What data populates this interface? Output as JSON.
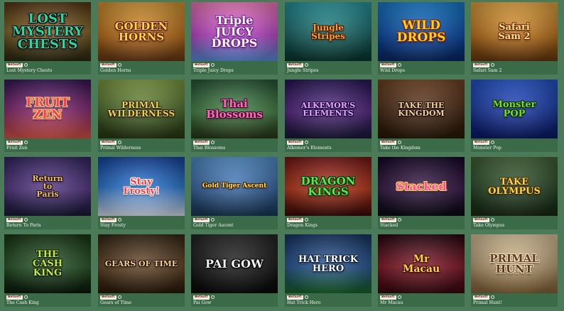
{
  "games": [
    {
      "id": "lost-mystery-chests",
      "name": "Lost Mystery Chests",
      "logo": "LOST\nMYSTERY CHESTS",
      "provider_badge": "Betsoft",
      "bg": "linear-gradient(180deg,#5a3a18,#8a6a2a 50%,#2a2a14)",
      "fg": "#2fd4a6",
      "shadow": "#000"
    },
    {
      "id": "golden-horns",
      "name": "Golden Horns",
      "logo": "GOLDEN\nHORNS",
      "provider_badge": "Betsoft",
      "bg": "linear-gradient(180deg,#e2a23a,#c2701a 60%,#6a3a14)",
      "fg": "#ffd24a",
      "shadow": "#5a1a08"
    },
    {
      "id": "triple-juicy-drops",
      "name": "Triple Juicy Drops",
      "logo": "Triple\nJUICY\nDROPS",
      "provider_badge": "Betsoft",
      "bg": "linear-gradient(180deg,#ff86c8,#c84ad4 55%,#5a9ae8)",
      "fg": "#ffffff",
      "shadow": "#7a1a9a"
    },
    {
      "id": "jungle-stripes",
      "name": "Jungle Stripes",
      "logo": "Jungle\nStripes",
      "provider_badge": "Betsoft",
      "bg": "linear-gradient(180deg,#2aa0a8,#1a6a6a 55%,#0a3a30)",
      "fg": "#ff9a2a",
      "shadow": "#3a1a0a"
    },
    {
      "id": "wild-drops",
      "name": "Wild Drops",
      "logo": "WILD\nDROPS",
      "provider_badge": "Betsoft",
      "bg": "linear-gradient(180deg,#1a86d8,#0a4aa8 60%,#0a2a6a)",
      "fg": "#ffd21a",
      "shadow": "#7a1a0a"
    },
    {
      "id": "safari-sam-2",
      "name": "Safari Sam 2",
      "logo": "Safari\nSam 2",
      "provider_badge": "Betsoft",
      "bg": "linear-gradient(180deg,#f2b24a,#c2741a 60%,#6a3a10)",
      "fg": "#ffe08a",
      "shadow": "#6a2a0a"
    },
    {
      "id": "fruit-zen",
      "name": "Fruit Zen",
      "logo": "FRUIT\nZEN",
      "provider_badge": "Betsoft",
      "bg": "linear-gradient(180deg,#3a1a5a,#8a2a7a 50%,#e85a4a)",
      "fg": "#ff3a4a",
      "shadow": "#ffe08a"
    },
    {
      "id": "primal-wilderness",
      "name": "Primal Wilderness",
      "logo": "PRIMAL\nWILDERNESS",
      "provider_badge": "Betsoft",
      "bg": "linear-gradient(180deg,#8aa84a,#4a6a2a 60%,#2a3a14)",
      "fg": "#e8d84a",
      "shadow": "#2a1a08"
    },
    {
      "id": "thai-blossoms",
      "name": "Thai Blossoms",
      "logo": "Thai\nBlossoms",
      "provider_badge": "Betsoft",
      "bg": "linear-gradient(180deg,#2a5a3a,#4a8a4a 55%,#2a3a1a)",
      "fg": "#ff6ab8",
      "shadow": "#3a0a2a"
    },
    {
      "id": "alkemors-elements",
      "name": "Alkemor's Elements",
      "logo": "ALKEMOR'S\nELEMENTS",
      "provider_badge": "Betsoft",
      "bg": "linear-gradient(180deg,#2a1a5a,#5a2a8a 55%,#1a1a3a)",
      "fg": "#e8a8ff",
      "shadow": "#1a0a3a"
    },
    {
      "id": "take-the-kingdom",
      "name": "Take the Kingdom",
      "logo": "TAKE THE\nKINGDOM",
      "provider_badge": "Betsoft",
      "bg": "linear-gradient(180deg,#7a4a2a,#4a2a14 55%,#2a1a0a)",
      "fg": "#f2d4a2",
      "shadow": "#1a0a04"
    },
    {
      "id": "monster-pop",
      "name": "Monster Pop",
      "logo": "Monster\nPOP",
      "provider_badge": "Betsoft",
      "bg": "linear-gradient(180deg,#2a5ad8,#1a3aa8 55%,#0a1a6a)",
      "fg": "#7adc2a",
      "shadow": "#0a2a0a"
    },
    {
      "id": "return-to-paris",
      "name": "Return To Paris",
      "logo": "Return\nto\nParis",
      "provider_badge": "Betsoft",
      "bg": "linear-gradient(180deg,#3a2a6a,#5a3a8a 55%,#1a1a3a)",
      "fg": "#f2c24a",
      "shadow": "#1a0a2a"
    },
    {
      "id": "stay-frosty",
      "name": "Stay Frosty",
      "logo": "Stay\nFrosty!",
      "provider_badge": "Betsoft",
      "bg": "linear-gradient(180deg,#1a4aa8,#2a7ad8 50%,#e8f2ff)",
      "fg": "#ff3a3a",
      "shadow": "#ffffff"
    },
    {
      "id": "gold-tiger-ascent",
      "name": "Gold Tiger Ascent",
      "logo": "Gold Tiger Ascent",
      "provider_badge": "Betsoft",
      "bg": "linear-gradient(180deg,#5a9ad8,#3a6aa8 55%,#1a3a5a)",
      "fg": "#ffe04a",
      "shadow": "#3a1a08"
    },
    {
      "id": "dragon-kings",
      "name": "Dragon Kings",
      "logo": "DRAGON\nKINGS",
      "provider_badge": "Betsoft",
      "bg": "linear-gradient(180deg,#7a1a1a,#c23a1a 55%,#3a0a08)",
      "fg": "#5ae84a",
      "shadow": "#0a2a0a"
    },
    {
      "id": "stacked",
      "name": "Stacked",
      "logo": "Stacked",
      "provider_badge": "Betsoft",
      "bg": "linear-gradient(180deg,#1a0a2a,#3a1a4a 55%,#0a0a14)",
      "fg": "#ff4ac2",
      "shadow": "#ffe04a"
    },
    {
      "id": "take-olympus",
      "name": "Take Olympus",
      "logo": "TAKE\nOLYMPUS",
      "provider_badge": "Betsoft",
      "bg": "linear-gradient(180deg,#4a6a3a,#2a4a2a 55%,#1a2a14)",
      "fg": "#ffd24a",
      "shadow": "#3a2a08"
    },
    {
      "id": "the-cash-king",
      "name": "The Cash King",
      "logo": "THE\nCASH\nKING",
      "provider_badge": "Betsoft",
      "bg": "linear-gradient(180deg,#1a3a1a,#2a5a2a 55%,#0a1a0a)",
      "fg": "#c8e84a",
      "shadow": "#0a1a04"
    },
    {
      "id": "gears-of-time",
      "name": "Gears of Time",
      "logo": "GEARS OF TIME",
      "provider_badge": "Betsoft",
      "bg": "linear-gradient(180deg,#3a2a1a,#6a4a2a 55%,#2a1a0a)",
      "fg": "#f2d48a",
      "shadow": "#1a0a04"
    },
    {
      "id": "pai-gow",
      "name": "Pai Gow",
      "logo": "PAI GOW",
      "provider_badge": "Betsoft",
      "bg": "linear-gradient(180deg,#2a2a2a,#1a1a1a 60%,#0a0a0a)",
      "fg": "#f2f2f2",
      "shadow": "#000000"
    },
    {
      "id": "hat-trick-hero",
      "name": "Hat Trick Hero",
      "logo": "HAT TRICK\nHERO",
      "provider_badge": "Betsoft",
      "bg": "linear-gradient(180deg,#1a3a6a,#2a5a9a 55%,#1a6a2a)",
      "fg": "#ffffff",
      "shadow": "#0a1a3a"
    },
    {
      "id": "mr-macau",
      "name": "Mr Macau",
      "logo": "Mr\nMacau",
      "provider_badge": "Betsoft",
      "bg": "linear-gradient(180deg,#2a0a14,#8a1a2a 55%,#3a0a10)",
      "fg": "#ffd24a",
      "shadow": "#3a0a08"
    },
    {
      "id": "primal-hunt",
      "name": "Primal Hunt!",
      "logo": "PRIMAL\nHUNT",
      "provider_badge": "Betsoft",
      "bg": "linear-gradient(180deg,#e8d2a8,#c2a478 55%,#8a6a3a)",
      "fg": "#5a3a1a",
      "shadow": "#f2e2c2"
    }
  ]
}
